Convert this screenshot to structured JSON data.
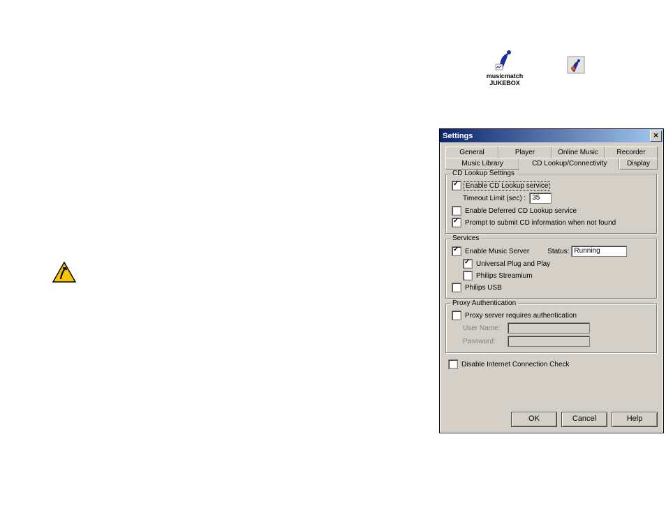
{
  "desktop": {
    "musicmatch_label_1": "musicmatch",
    "musicmatch_label_2": "JUKEBOX"
  },
  "window": {
    "title": "Settings",
    "tabs_row1": {
      "general": "General",
      "player": "Player",
      "online": "Online Music",
      "recorder": "Recorder"
    },
    "tabs_row2": {
      "library": "Music Library",
      "cdlookup": "CD Lookup/Connectivity",
      "display": "Display"
    },
    "cdlookup_group": {
      "legend": "CD Lookup Settings",
      "enable_service": "Enable CD Lookup service",
      "timeout_label": "Timeout Limit (sec) :",
      "timeout_value": "35",
      "enable_deferred": "Enable Deferred CD Lookup service",
      "prompt_submit": "Prompt to submit CD information when not found"
    },
    "services_group": {
      "legend": "Services",
      "enable_server": "Enable Music Server",
      "status_label": "Status:",
      "status_value": "Running",
      "upnp": "Universal Plug and Play",
      "streamium": "Philips Streamium",
      "usb": "Philips USB"
    },
    "proxy_group": {
      "legend": "Proxy Authentication",
      "proxy_required": "Proxy server requires authentication",
      "user_label": "User Name:",
      "pass_label": "Password:"
    },
    "disable_inet": "Disable Internet Connection Check",
    "buttons": {
      "ok": "OK",
      "cancel": "Cancel",
      "help": "Help"
    }
  }
}
